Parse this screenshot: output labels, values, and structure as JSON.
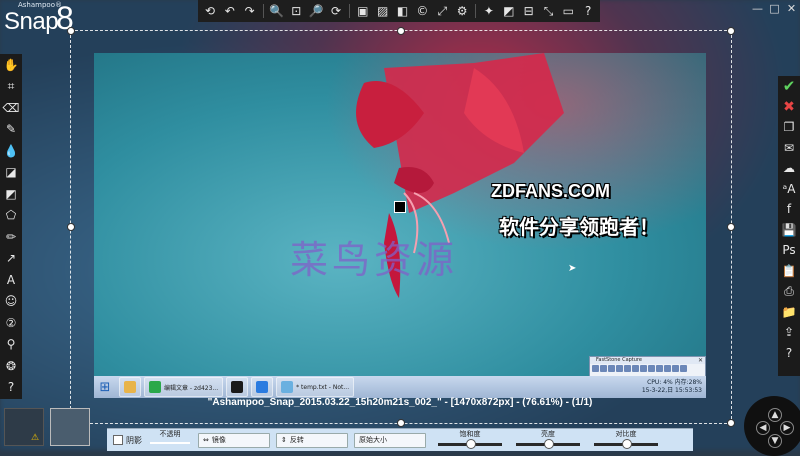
{
  "app": {
    "brand": "Ashampoo®",
    "name": "Snap",
    "version": "8"
  },
  "top_toolbar": {
    "buttons": [
      {
        "name": "undo-all-icon",
        "glyph": "⟲"
      },
      {
        "name": "undo-icon",
        "glyph": "↶"
      },
      {
        "name": "redo-icon",
        "glyph": "↷"
      },
      {
        "name": "zoom-out-icon",
        "glyph": "🔍"
      },
      {
        "name": "zoom-fit-icon",
        "glyph": "⊡"
      },
      {
        "name": "zoom-in-icon",
        "glyph": "🔎"
      },
      {
        "name": "rotate-icon",
        "glyph": "⟳"
      },
      {
        "name": "image-effects-icon",
        "glyph": "▣"
      },
      {
        "name": "image-frame-icon",
        "glyph": "▨"
      },
      {
        "name": "color-fill-icon",
        "glyph": "◧"
      },
      {
        "name": "copyright-icon",
        "glyph": "©"
      },
      {
        "name": "resize-icon",
        "glyph": "⤢"
      },
      {
        "name": "settings-icon",
        "glyph": "⚙"
      },
      {
        "name": "magic-wand-icon",
        "glyph": "✦"
      },
      {
        "name": "crop-edge-icon",
        "glyph": "◩"
      },
      {
        "name": "fit-icon",
        "glyph": "⊟"
      },
      {
        "name": "shrink-icon",
        "glyph": "⤡"
      },
      {
        "name": "border-icon",
        "glyph": "▭"
      },
      {
        "name": "help-icon",
        "glyph": "?"
      }
    ]
  },
  "window_controls": {
    "minimize": "—",
    "maximize": "□",
    "close": "✕"
  },
  "left_toolbar": [
    {
      "name": "hand-tool-icon",
      "glyph": "✋"
    },
    {
      "name": "crop-tool-icon",
      "glyph": "⌗"
    },
    {
      "name": "eraser-tool-icon",
      "glyph": "⌫"
    },
    {
      "name": "pen-tool-icon",
      "glyph": "✎"
    },
    {
      "name": "color-drop-icon",
      "glyph": "💧"
    },
    {
      "name": "fill-tool-icon",
      "glyph": "◪"
    },
    {
      "name": "highlight-tool-icon",
      "glyph": "◩"
    },
    {
      "name": "shapes-tool-icon",
      "glyph": "⬠"
    },
    {
      "name": "pencil-tool-icon",
      "glyph": "✏"
    },
    {
      "name": "arrow-tool-icon",
      "glyph": "↗"
    },
    {
      "name": "text-tool-icon",
      "glyph": "A"
    },
    {
      "name": "smiley-tool-icon",
      "glyph": "☺"
    },
    {
      "name": "numbering-tool-icon",
      "glyph": "②"
    },
    {
      "name": "stamp-tool-icon",
      "glyph": "⚲"
    },
    {
      "name": "blur-tool-icon",
      "glyph": "❂"
    },
    {
      "name": "help-tool-icon",
      "glyph": "?"
    }
  ],
  "right_toolbar": [
    {
      "name": "accept-icon",
      "glyph": "✔",
      "cls": "rt-ok"
    },
    {
      "name": "cancel-icon",
      "glyph": "✖",
      "cls": "rt-cancel"
    },
    {
      "name": "copy-icon",
      "glyph": "❐",
      "cls": ""
    },
    {
      "name": "email-icon",
      "glyph": "✉",
      "cls": ""
    },
    {
      "name": "upload-cloud-icon",
      "glyph": "☁",
      "cls": ""
    },
    {
      "name": "ocr-icon",
      "glyph": "ᵃA",
      "cls": ""
    },
    {
      "name": "facebook-icon",
      "glyph": "f",
      "cls": ""
    },
    {
      "name": "save-icon",
      "glyph": "💾",
      "cls": ""
    },
    {
      "name": "photoshop-icon",
      "glyph": "Ps",
      "cls": ""
    },
    {
      "name": "clipboard-icon",
      "glyph": "📋",
      "cls": ""
    },
    {
      "name": "print-icon",
      "glyph": "⎙",
      "cls": ""
    },
    {
      "name": "folder-icon",
      "glyph": "📁",
      "cls": ""
    },
    {
      "name": "export-icon",
      "glyph": "⇪",
      "cls": ""
    },
    {
      "name": "help-right-icon",
      "glyph": "?",
      "cls": ""
    }
  ],
  "canvas": {
    "text_line1": "ZDFANS.COM",
    "text_line2": "软件分享领跑者！",
    "watermark": "菜鸟资源"
  },
  "taskbar": {
    "items": [
      {
        "label": "编辑文章 - zd423...",
        "color": "#2aa84a"
      },
      {
        "label": "",
        "color": "#1a1a1a"
      },
      {
        "label": "",
        "color": "#2a7be0"
      },
      {
        "label": "* temp.txt - Not...",
        "color": "#6ab0e0"
      }
    ],
    "tray_line1": "CPU: 4%  内存:28%",
    "tray_line2": "15-3-22,日 15:53:53"
  },
  "faststone": {
    "title": "FastStone Capture",
    "close": "✕"
  },
  "caption": "\"Ashampoo_Snap_2015.03.22_15h20m21s_002_\" - [1470x872px] - (76.61%) - (1/1)",
  "bottom_panel": {
    "shadow_label": "阴影",
    "opacity_label": "不透明",
    "mirror_label": "镜像",
    "invert_label": "反转",
    "original_size_label": "原始大小",
    "saturation_label": "饱和度",
    "brightness_label": "亮度",
    "contrast_label": "对比度",
    "saturation_value": 0.5,
    "brightness_value": 0.5,
    "contrast_value": 0.5
  },
  "colors": {
    "toolbar_bg": "#1b1b1b",
    "panel_bg": "#cfe2f4",
    "accept": "#5fd35f",
    "cancel": "#e84545"
  }
}
